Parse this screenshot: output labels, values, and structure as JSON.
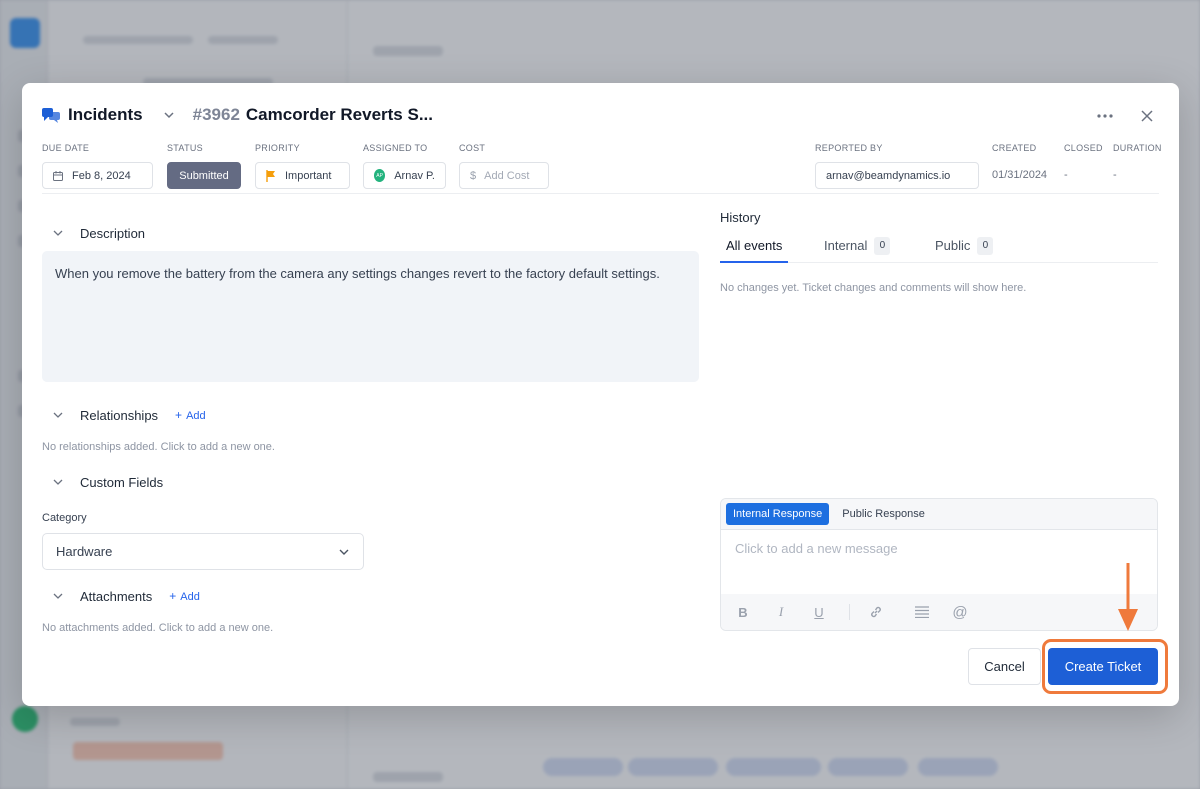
{
  "modal": {
    "module_name": "Incidents",
    "ticket_number": "#3962",
    "ticket_title": "Camcorder Reverts S...",
    "fields": {
      "due_date": {
        "label": "DUE DATE",
        "value": "Feb 8, 2024"
      },
      "status": {
        "label": "STATUS",
        "value": "Submitted"
      },
      "priority": {
        "label": "PRIORITY",
        "value": "Important"
      },
      "assigned_to": {
        "label": "ASSIGNED TO",
        "initials": "AP",
        "value": "Arnav P."
      },
      "cost": {
        "label": "COST",
        "placeholder": "Add Cost"
      },
      "reported_by": {
        "label": "REPORTED BY",
        "value": "arnav@beamdynamics.io"
      },
      "created": {
        "label": "CREATED",
        "value": "01/31/2024"
      },
      "closed": {
        "label": "CLOSED",
        "value": "-"
      },
      "duration": {
        "label": "DURATION",
        "value": "-"
      }
    },
    "description": {
      "title": "Description",
      "text": "When you remove the battery from the camera any settings changes revert to the factory default settings."
    },
    "relationships": {
      "title": "Relationships",
      "add_label": "Add",
      "empty": "No relationships added. Click to add a new one."
    },
    "custom_fields": {
      "title": "Custom Fields",
      "category_label": "Category",
      "category_value": "Hardware"
    },
    "attachments": {
      "title": "Attachments",
      "add_label": "Add",
      "empty": "No attachments added. Click to add a new one."
    },
    "history": {
      "title": "History",
      "tabs": [
        {
          "label": "All events"
        },
        {
          "label": "Internal",
          "count": "0"
        },
        {
          "label": "Public",
          "count": "0"
        }
      ],
      "empty": "No changes yet. Ticket changes and comments will show here."
    },
    "composer": {
      "tabs": [
        "Internal Response",
        "Public Response"
      ],
      "placeholder": "Click to add a new message",
      "tools": {
        "bold": "B",
        "italic": "I",
        "underline": "U",
        "mention": "@"
      }
    },
    "buttons": {
      "cancel": "Cancel",
      "create": "Create Ticket"
    }
  },
  "colors": {
    "accent": "#1d5fd6",
    "status_bg": "#646b83",
    "highlight": "#ef7a3c",
    "priority_flag": "#f59e0b"
  }
}
